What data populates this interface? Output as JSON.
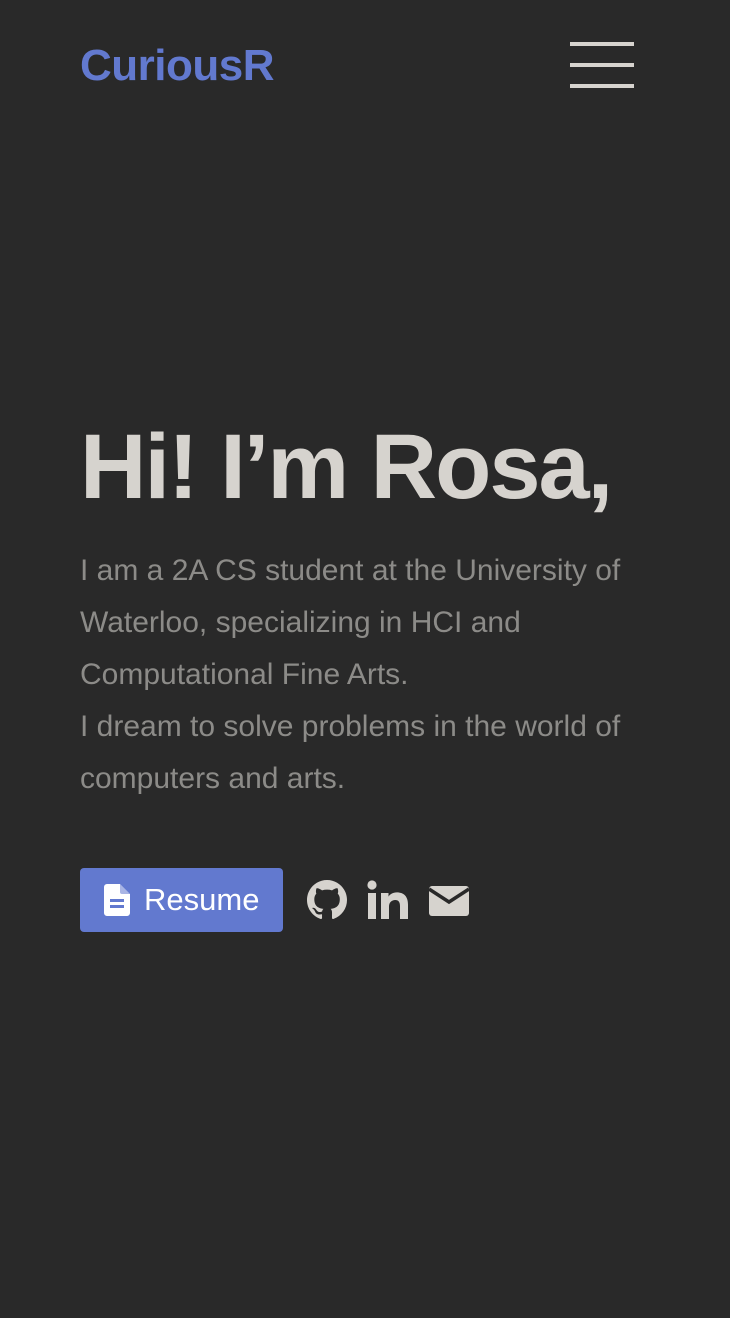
{
  "header": {
    "logo": "CuriousR",
    "menu_icon": "hamburger-menu-icon"
  },
  "hero": {
    "title": "Hi! I’m Rosa,",
    "intro_line_1": "I am a 2A CS student at the University of Waterloo, specializing in HCI and Computational Fine Arts.",
    "intro_line_2": "I dream to solve problems in the world of computers and arts."
  },
  "actions": {
    "resume_label": "Resume",
    "resume_icon": "document-icon",
    "social_icons": [
      "github-icon",
      "linkedin-icon",
      "mail-icon"
    ]
  },
  "colors": {
    "background": "#292929",
    "accent": "#6279cf",
    "heading": "#d6d3ce",
    "body_text": "#8c8b88"
  }
}
